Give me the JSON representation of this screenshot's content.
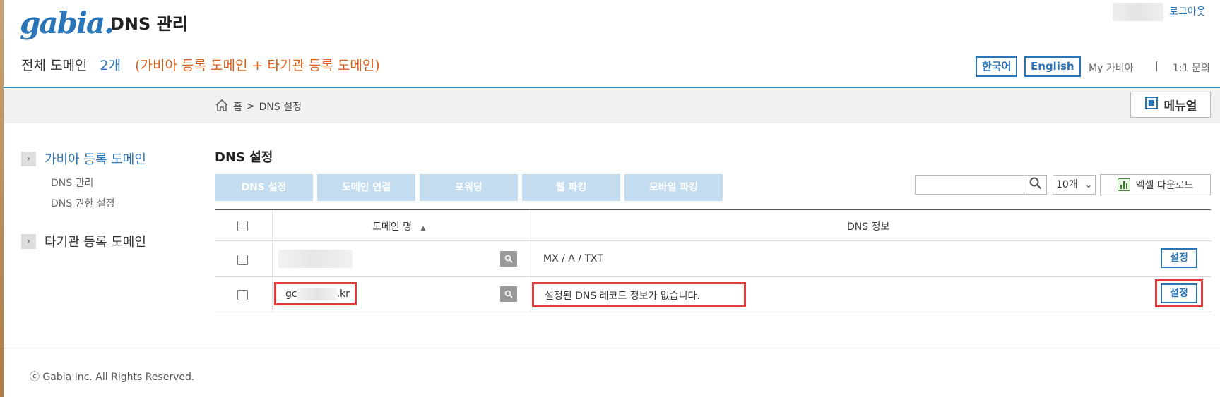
{
  "header": {
    "logo_text": "gabia.",
    "app_title": "DNS 관리",
    "logout": "로그아웃",
    "domain_count_label": "전체 도메인",
    "domain_count": "2개",
    "domain_count_desc": "(가비아 등록 도메인 + 타기관 등록 도메인)",
    "lang_korean": "한국어",
    "lang_english": "English",
    "my_gabia": "My 가비아",
    "separator": "|",
    "inquiry": "1:1 문의"
  },
  "breadcrumb": {
    "home": "홈",
    "sep": ">",
    "current": "DNS 설정"
  },
  "manual_label": "메뉴얼",
  "sidebar": {
    "section1": {
      "label": "가비아 등록 도메인",
      "items": [
        "DNS 관리",
        "DNS 권한 설정"
      ]
    },
    "section2": {
      "label": "타기관 등록 도메인"
    }
  },
  "main": {
    "title": "DNS 설정",
    "tabs": [
      "DNS 설정",
      "도메인 연결",
      "포워딩",
      "웹 파킹",
      "모바일 파킹"
    ],
    "search_value": "",
    "page_size": "10개",
    "excel_label": "엑셀 다운로드"
  },
  "table": {
    "headers": {
      "domain": "도메인 명",
      "sort_icon": "▲",
      "dns_info": "DNS 정보"
    },
    "rows": [
      {
        "domain": "",
        "dns_info": "MX / A / TXT",
        "action": "설정"
      },
      {
        "domain_prefix": "gc",
        "domain_suffix": ".kr",
        "dns_info": "설정된 DNS 레코드 정보가 없습니다.",
        "action": "설정"
      }
    ]
  },
  "footer": {
    "copyright": "ⓒ Gabia Inc. All Rights Reserved."
  },
  "colors": {
    "brand": "#2a74b8",
    "highlight": "#e03a3a",
    "tab_bg": "#c3dcf0",
    "count_desc": "#d9601a"
  }
}
